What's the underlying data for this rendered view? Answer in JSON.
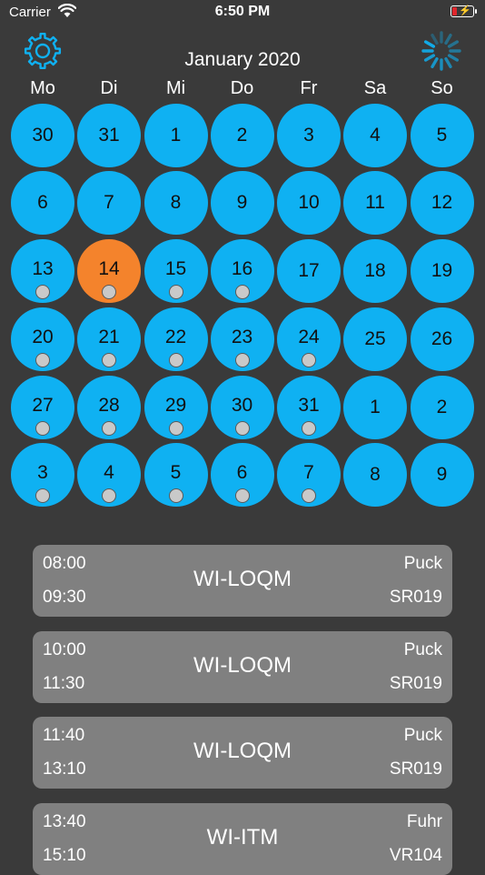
{
  "status_bar": {
    "carrier": "Carrier",
    "time": "6:50 PM"
  },
  "header": {
    "settings_icon": "gear-icon",
    "loading_icon": "activity-spinner-icon",
    "month_title": "January 2020"
  },
  "weekdays": [
    "Mo",
    "Di",
    "Mi",
    "Do",
    "Fr",
    "Sa",
    "So"
  ],
  "colors": {
    "background": "#3a3a3a",
    "day": "#0fb1f2",
    "selected_day": "#f4832c",
    "event_card": "#808080",
    "event_dot": "#c9c9c9"
  },
  "calendar": {
    "selected": "14",
    "weeks": [
      [
        {
          "day": "30",
          "event": false
        },
        {
          "day": "31",
          "event": false
        },
        {
          "day": "1",
          "event": false
        },
        {
          "day": "2",
          "event": false
        },
        {
          "day": "3",
          "event": false
        },
        {
          "day": "4",
          "event": false
        },
        {
          "day": "5",
          "event": false
        }
      ],
      [
        {
          "day": "6",
          "event": false
        },
        {
          "day": "7",
          "event": false
        },
        {
          "day": "8",
          "event": false
        },
        {
          "day": "9",
          "event": false
        },
        {
          "day": "10",
          "event": false
        },
        {
          "day": "11",
          "event": false
        },
        {
          "day": "12",
          "event": false
        }
      ],
      [
        {
          "day": "13",
          "event": true
        },
        {
          "day": "14",
          "event": true,
          "selected": true
        },
        {
          "day": "15",
          "event": true
        },
        {
          "day": "16",
          "event": true
        },
        {
          "day": "17",
          "event": false
        },
        {
          "day": "18",
          "event": false
        },
        {
          "day": "19",
          "event": false
        }
      ],
      [
        {
          "day": "20",
          "event": true
        },
        {
          "day": "21",
          "event": true
        },
        {
          "day": "22",
          "event": true
        },
        {
          "day": "23",
          "event": true
        },
        {
          "day": "24",
          "event": true
        },
        {
          "day": "25",
          "event": false
        },
        {
          "day": "26",
          "event": false
        }
      ],
      [
        {
          "day": "27",
          "event": true
        },
        {
          "day": "28",
          "event": true
        },
        {
          "day": "29",
          "event": true
        },
        {
          "day": "30",
          "event": true
        },
        {
          "day": "31",
          "event": true
        },
        {
          "day": "1",
          "event": false
        },
        {
          "day": "2",
          "event": false
        }
      ],
      [
        {
          "day": "3",
          "event": true
        },
        {
          "day": "4",
          "event": true
        },
        {
          "day": "5",
          "event": true
        },
        {
          "day": "6",
          "event": true
        },
        {
          "day": "7",
          "event": true
        },
        {
          "day": "8",
          "event": false
        },
        {
          "day": "9",
          "event": false
        }
      ]
    ]
  },
  "events": [
    {
      "start": "08:00",
      "end": "09:30",
      "course": "WI-LOQM",
      "lecturer": "Puck",
      "room": "SR019"
    },
    {
      "start": "10:00",
      "end": "11:30",
      "course": "WI-LOQM",
      "lecturer": "Puck",
      "room": "SR019"
    },
    {
      "start": "11:40",
      "end": "13:10",
      "course": "WI-LOQM",
      "lecturer": "Puck",
      "room": "SR019"
    },
    {
      "start": "13:40",
      "end": "15:10",
      "course": "WI-ITM",
      "lecturer": "Fuhr",
      "room": "VR104"
    }
  ]
}
